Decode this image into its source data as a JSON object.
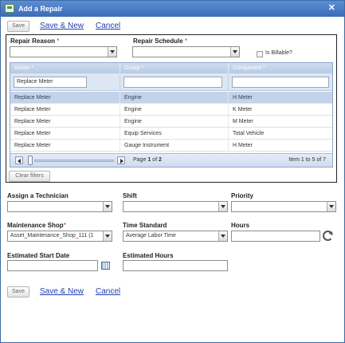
{
  "window": {
    "title": "Add a Repair",
    "close_glyph": "✕"
  },
  "toolbar_top": {
    "save": "Save",
    "save_new": "Save & New",
    "cancel": "Cancel"
  },
  "repair": {
    "reason_label": "Repair Reason",
    "schedule_label": "Repair Schedule",
    "required_mark": "*",
    "billable_label": "Is Billable?"
  },
  "grid": {
    "columns": [
      "Action *",
      "Group *",
      "Component *"
    ],
    "filter_value": "Replace Meter",
    "rows": [
      [
        "Replace Meter",
        "Engine",
        "H Meter"
      ],
      [
        "Replace Meter",
        "Engine",
        "K Meter"
      ],
      [
        "Replace Meter",
        "Engine",
        "M Meter"
      ],
      [
        "Replace Meter",
        "Equip Services",
        "Total Vehicle"
      ],
      [
        "Replace Meter",
        "Gauge Instrument",
        "H Meter"
      ]
    ],
    "pager": {
      "page_word": "Page",
      "page": "1",
      "of_word": "of",
      "pages": "2",
      "info": "Item 1 to 5 of 7"
    },
    "clear_filters": "Clear filters"
  },
  "form": {
    "technician_label": "Assign a Technician",
    "shift_label": "Shift",
    "priority_label": "Priority",
    "shop_label": "Maintenance Shop",
    "shop_value": "Asset_Maintenance_Shop_111 (1",
    "time_std_label": "Time Standard",
    "time_std_value": "Average Labor Time",
    "hours_label": "Hours",
    "start_date_label": "Estimated Start Date",
    "est_hours_label": "Estimated Hours"
  },
  "toolbar_bottom": {
    "save": "Save",
    "save_new": "Save & New",
    "cancel": "Cancel"
  },
  "colors": {
    "title_bar": "#3a6bb8",
    "link": "#1f3fae",
    "required": "#d01f1f",
    "selected_row": "#c3d3ea"
  },
  "icons": [
    "window-icon",
    "close-icon",
    "chevron-down-icon",
    "calendar-icon",
    "refresh-icon",
    "prev-page-icon",
    "next-page-icon"
  ]
}
